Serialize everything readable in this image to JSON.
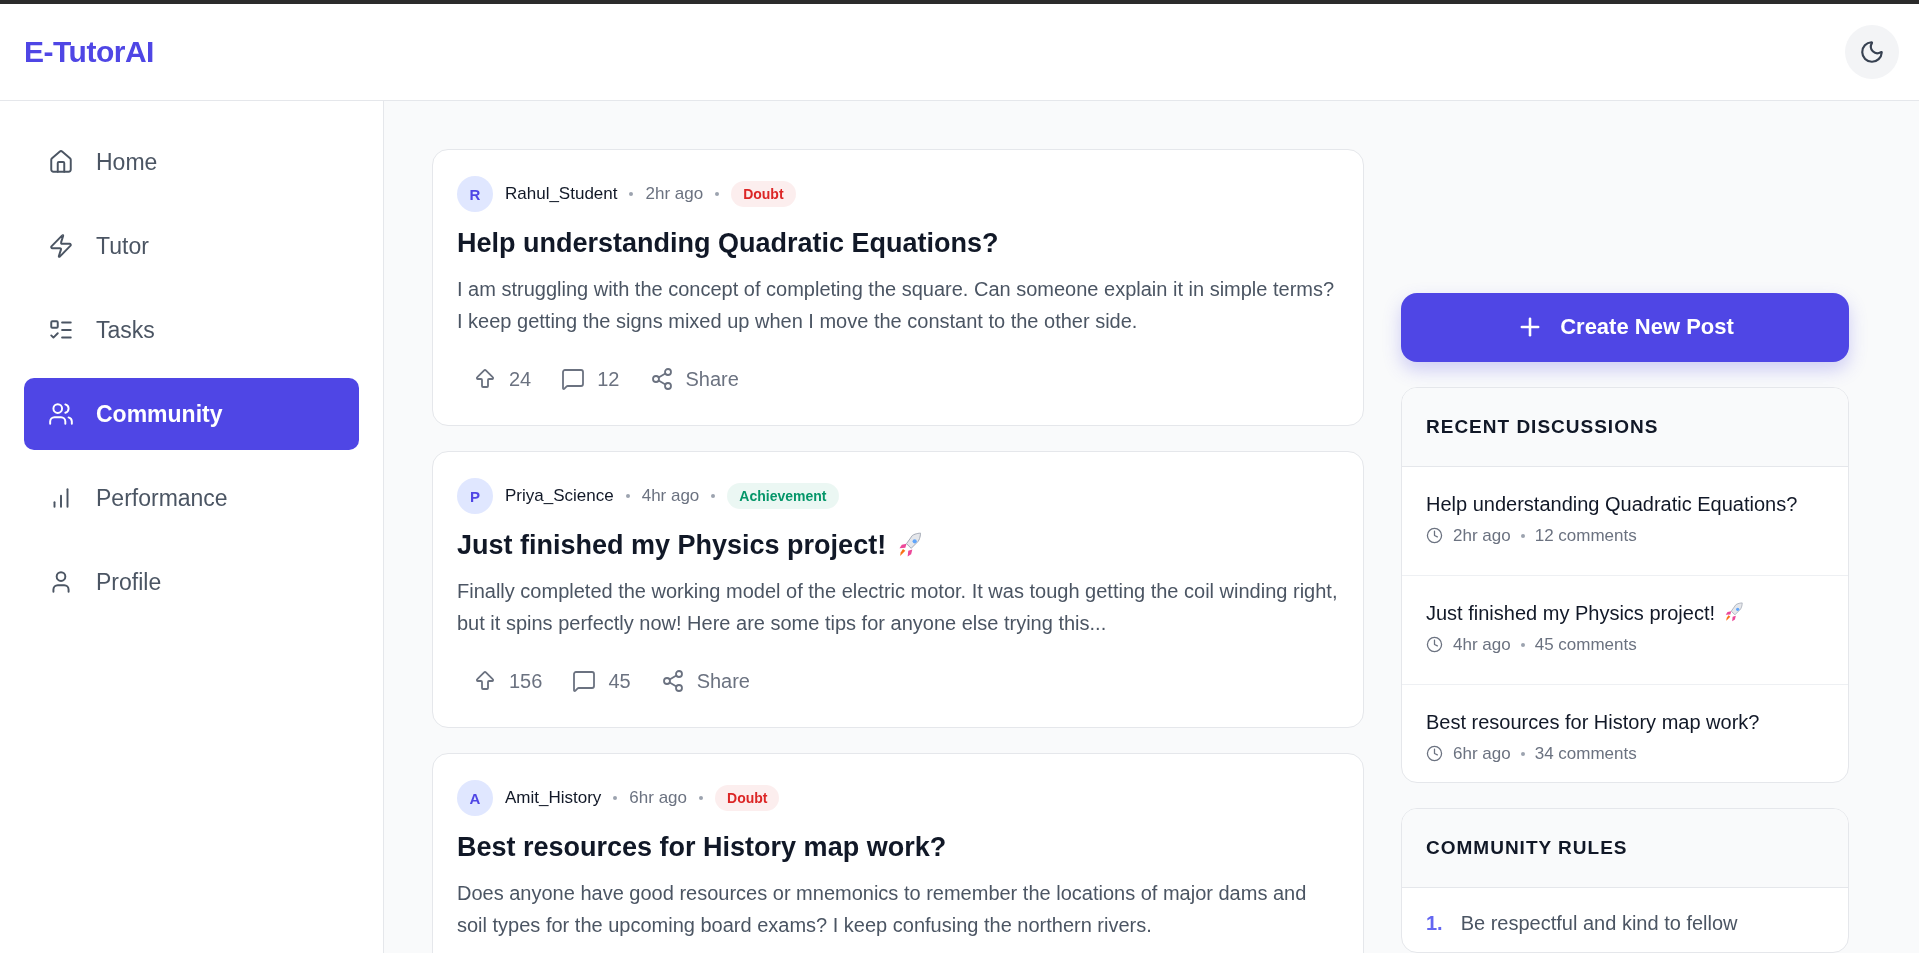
{
  "header": {
    "logo": "E-TutorAI"
  },
  "sidebar": {
    "items": [
      {
        "label": "Home",
        "selected": false
      },
      {
        "label": "Tutor",
        "selected": false
      },
      {
        "label": "Tasks",
        "selected": false
      },
      {
        "label": "Community",
        "selected": true
      },
      {
        "label": "Performance",
        "selected": false
      },
      {
        "label": "Profile",
        "selected": false
      }
    ]
  },
  "posts": [
    {
      "initial": "R",
      "author": "Rahul_Student",
      "time": "2hr ago",
      "tag": {
        "label": "Doubt",
        "color": "#dc2626"
      },
      "title": "Help understanding Quadratic Equations?",
      "rocket": false,
      "body": "I am struggling with the concept of completing the square. Can someone explain it in simple terms? I keep getting the signs mixed up when I move the constant to the other side.",
      "upvotes": "24",
      "comments": "12",
      "share": "Share"
    },
    {
      "initial": "P",
      "author": "Priya_Science",
      "time": "4hr ago",
      "tag": {
        "label": "Achievement",
        "color": "#059669"
      },
      "title": "Just finished my Physics project!",
      "rocket": true,
      "body": "Finally completed the working model of the electric motor. It was tough getting the coil winding right, but it spins perfectly now! Here are some tips for anyone else trying this...",
      "upvotes": "156",
      "comments": "45",
      "share": "Share"
    },
    {
      "initial": "A",
      "author": "Amit_History",
      "time": "6hr ago",
      "tag": {
        "label": "Doubt",
        "color": "#dc2626"
      },
      "title": "Best resources for History map work?",
      "rocket": false,
      "body": "Does anyone have good resources or mnemonics to remember the locations of major dams and soil types for the upcoming board exams? I keep confusing the northern rivers."
    }
  ],
  "create_button": "Create New Post",
  "recent": {
    "title": "RECENT DISCUSSIONS",
    "items": [
      {
        "title": "Help understanding Quadratic Equations?",
        "rocket": false,
        "time": "2hr ago",
        "comments": "12 comments"
      },
      {
        "title": "Just finished my Physics project!",
        "rocket": true,
        "time": "4hr ago",
        "comments": "45 comments"
      },
      {
        "title": "Best resources for History map work?",
        "rocket": false,
        "time": "6hr ago",
        "comments": "34 comments"
      }
    ]
  },
  "rules": {
    "title": "COMMUNITY RULES",
    "items": [
      {
        "number": "1.",
        "text": "Be respectful and kind to fellow"
      }
    ]
  }
}
